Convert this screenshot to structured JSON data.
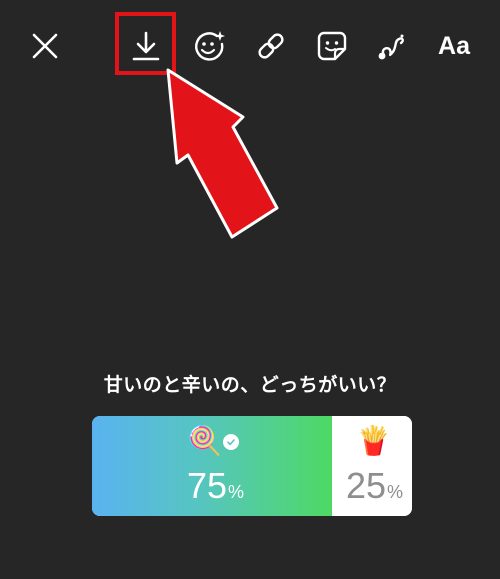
{
  "toolbar": {
    "close_icon": "close-icon",
    "download_icon": "download-icon",
    "effects_icon": "face-effects-icon",
    "link_icon": "link-icon",
    "sticker_icon": "sticker-icon",
    "draw_icon": "draw-icon",
    "text_label": "Aa"
  },
  "annotation": {
    "highlight_color": "#e2141a",
    "arrow_color": "#e2141a"
  },
  "poll": {
    "question": "甘いのと辛いの、どっちがいい？",
    "options": [
      {
        "emoji": "🍭",
        "emoji_name": "lollipop-icon",
        "percent": "75",
        "unit": "%",
        "selected": true
      },
      {
        "emoji": "🍟",
        "emoji_name": "fries-icon",
        "percent": "25",
        "unit": "%",
        "selected": false
      }
    ],
    "colors": {
      "gradient_start": "#5ab3f0",
      "gradient_end": "#4ed964",
      "unselected_bg": "#ffffff",
      "selected_text": "#ffffff",
      "unselected_text": "#8e8e8e"
    }
  }
}
